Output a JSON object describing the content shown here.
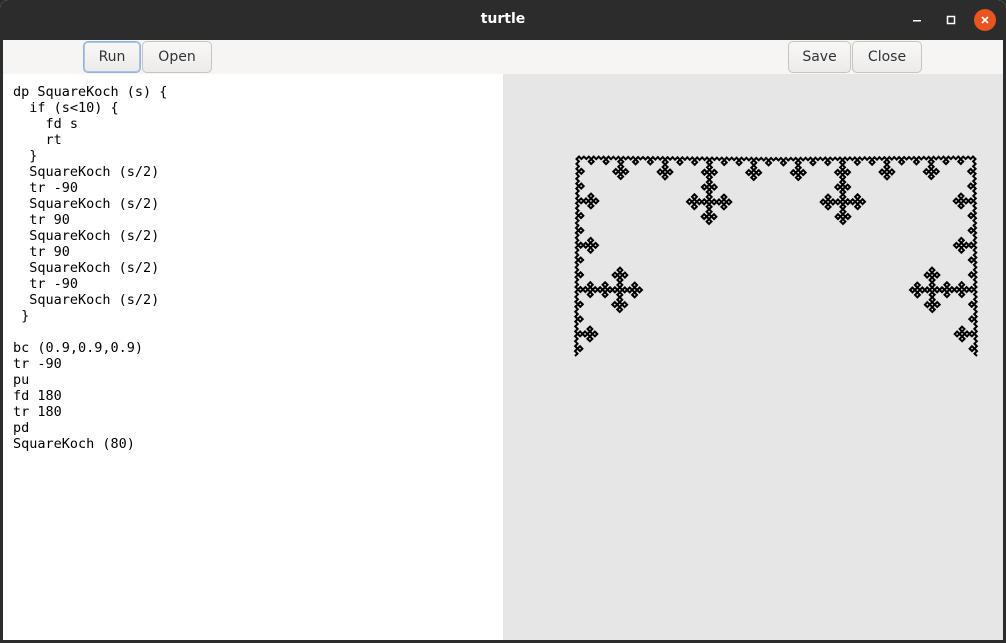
{
  "window": {
    "title": "turtle"
  },
  "toolbar": {
    "run_label": "Run",
    "open_label": "Open",
    "save_label": "Save",
    "close_label": "Close"
  },
  "editor": {
    "code": "dp SquareKoch (s) {\n  if (s<10) {\n    fd s\n    rt\n  }\n  SquareKoch (s/2)\n  tr -90\n  SquareKoch (s/2)\n  tr 90\n  SquareKoch (s/2)\n  tr 90\n  SquareKoch (s/2)\n  tr -90\n  SquareKoch (s/2)\n }\n\nbc (0.9,0.9,0.9)\ntr -90\npu\nfd 180\ntr 180\npd\nSquareKoch (80)"
  },
  "canvas": {
    "background": "#e6e6e6",
    "stroke": "#000000"
  },
  "colors": {
    "titlebar": "#2c2c2c",
    "close_button": "#e95420"
  }
}
